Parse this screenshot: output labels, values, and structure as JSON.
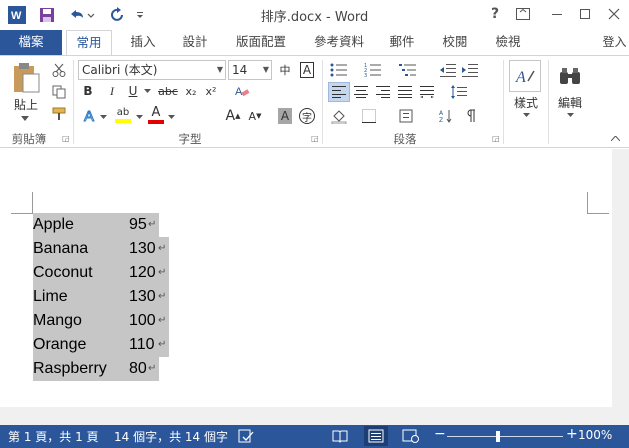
{
  "window": {
    "title": "排序.docx - Word",
    "help": "?",
    "signin": "登入"
  },
  "tabs": [
    "檔案",
    "常用",
    "插入",
    "設計",
    "版面配置",
    "參考資料",
    "郵件",
    "校閱",
    "檢視"
  ],
  "ribbon": {
    "clipboard": {
      "paste_label": "貼上",
      "group_label": "剪貼簿"
    },
    "font": {
      "font_name": "Calibri (本文)",
      "font_size": "14",
      "bold": "B",
      "italic": "I",
      "underline": "U",
      "strike": "abc",
      "subscript": "x₂",
      "superscript": "x²",
      "grow": "A",
      "shrink": "A",
      "text_highlight": "ab",
      "font_color": "A",
      "char_shading": "A",
      "enclose": "字",
      "text_effects": "A",
      "phonetic": "中",
      "border_char": "A",
      "group_label": "字型"
    },
    "paragraph": {
      "group_label": "段落"
    },
    "styles": {
      "label": "樣式"
    },
    "editing": {
      "label": "編輯"
    }
  },
  "document": {
    "rows": [
      {
        "fruit": "Apple",
        "value": "95"
      },
      {
        "fruit": "Banana",
        "value": "130"
      },
      {
        "fruit": "Coconut",
        "value": "120"
      },
      {
        "fruit": "Lime",
        "value": "130"
      },
      {
        "fruit": "Mango",
        "value": "100"
      },
      {
        "fruit": "Orange",
        "value": "110"
      },
      {
        "fruit": "Raspberry",
        "value": "80"
      }
    ],
    "paragraph_mark": "↵"
  },
  "status": {
    "page": "第 1 頁，共 1 頁",
    "words": "14 個字，共 14 個字",
    "zoom": "100%",
    "zoom_minus": "−",
    "zoom_plus": "+"
  },
  "colors": {
    "accent": "#2b579a",
    "highlight": "#c6c6c6",
    "highlighter_yellow": "#ffff00",
    "font_red": "#e00000"
  }
}
